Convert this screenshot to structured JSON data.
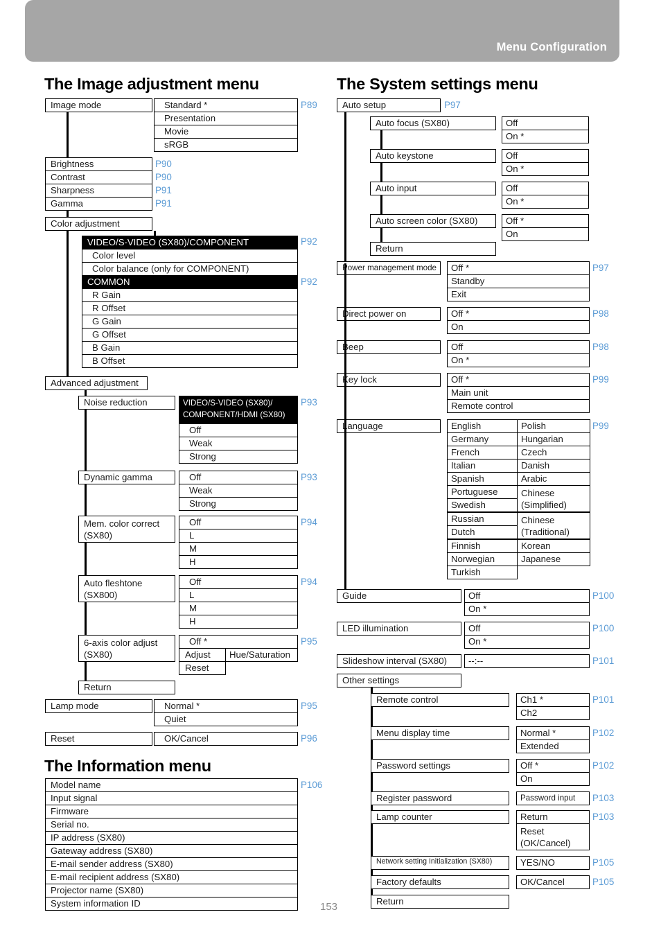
{
  "header": {
    "title": "Menu Configuration"
  },
  "page_number": "153",
  "colors": {
    "header_bg": "#a6a6a6",
    "page_ref": "#5b9bd5",
    "highlight_bg": "#000000"
  },
  "sections": {
    "image_adjustment": {
      "heading": "The Image adjustment menu",
      "image_mode": {
        "label": "Image mode",
        "ref": "P89",
        "options": [
          "Standard *",
          "Presentation",
          "Movie",
          "sRGB"
        ]
      },
      "simple_items": [
        {
          "label": "Brightness",
          "ref": "P90"
        },
        {
          "label": "Contrast",
          "ref": "P90"
        },
        {
          "label": "Sharpness",
          "ref": "P91"
        },
        {
          "label": "Gamma",
          "ref": "P91"
        }
      ],
      "color_adjustment": {
        "label": "Color adjustment",
        "groups": [
          {
            "header": "VIDEO/S-VIDEO (SX80)/COMPONENT",
            "ref": "P92",
            "items": [
              "Color level",
              "Color balance (only for COMPONENT)"
            ]
          },
          {
            "header": "COMMON",
            "ref": "P92",
            "items": [
              "R Gain",
              "R Offset",
              "G Gain",
              "G Offset",
              "B Gain",
              "B Offset"
            ]
          }
        ]
      },
      "advanced_adjustment": {
        "label": "Advanced adjustment",
        "entries": [
          {
            "label": "Noise reduction",
            "ref": "P93",
            "header": "VIDEO/S-VIDEO (SX80)/ COMPONENT/HDMI (SX80)",
            "options": [
              "Off",
              "Weak",
              "Strong"
            ]
          },
          {
            "label": "Dynamic gamma",
            "ref": "P93",
            "options": [
              "Off",
              "Weak",
              "Strong"
            ]
          },
          {
            "label": "Mem. color correct (SX80)",
            "ref": "P94",
            "options": [
              "Off",
              "L",
              "M",
              "H"
            ]
          },
          {
            "label": "Auto fleshtone (SX800)",
            "ref": "P94",
            "options": [
              "Off",
              "L",
              "M",
              "H"
            ]
          },
          {
            "label": "6-axis color adjust (SX80)",
            "ref": "P95",
            "options": [
              "Off *",
              "Adjust",
              "Reset"
            ],
            "sub_option": "Hue/Saturation"
          }
        ],
        "return_label": "Return"
      },
      "lamp_mode": {
        "label": "Lamp mode",
        "ref": "P95",
        "options": [
          "Normal *",
          "Quiet"
        ]
      },
      "reset": {
        "label": "Reset",
        "ref": "P96",
        "options": [
          "OK/Cancel"
        ]
      }
    },
    "information": {
      "heading": "The Information menu",
      "ref": "P106",
      "items": [
        "Model name",
        "Input signal",
        "Firmware",
        "Serial no.",
        "IP address (SX80)",
        "Gateway address (SX80)",
        "E-mail sender address (SX80)",
        "E-mail recipient address (SX80)",
        "Projector name (SX80)",
        "System information ID"
      ]
    },
    "system_settings": {
      "heading": "The System settings menu",
      "auto_setup": {
        "label": "Auto setup",
        "ref": "P97",
        "entries": [
          {
            "label": "Auto focus (SX80)",
            "options": [
              "Off",
              "On *"
            ]
          },
          {
            "label": "Auto keystone",
            "options": [
              "Off",
              "On *"
            ]
          },
          {
            "label": "Auto input",
            "options": [
              "Off",
              "On *"
            ]
          },
          {
            "label": "Auto screen color (SX80)",
            "options": [
              "Off *",
              "On"
            ]
          }
        ],
        "return_label": "Return"
      },
      "items": [
        {
          "label": "Power management mode",
          "ref": "P97",
          "options": [
            "Off *",
            "Standby",
            "Exit"
          ]
        },
        {
          "label": "Direct power on",
          "ref": "P98",
          "options": [
            "Off *",
            "On"
          ]
        },
        {
          "label": "Beep",
          "ref": "P98",
          "options": [
            "Off",
            "On *"
          ]
        },
        {
          "label": "Key lock",
          "ref": "P99",
          "options": [
            "Off *",
            "Main unit",
            "Remote control"
          ]
        }
      ],
      "language": {
        "label": "Language",
        "ref": "P99",
        "col1": [
          "English",
          "Germany",
          "French",
          "Italian",
          "Spanish",
          "Portuguese",
          "Swedish",
          "Russian",
          "Dutch",
          "Finnish",
          "Norwegian",
          "Turkish"
        ],
        "col2": [
          "Polish",
          "Hungarian",
          "Czech",
          "Danish",
          "Arabic",
          "Chinese (Simplified)",
          "Chinese (Traditional)",
          "Korean",
          "Japanese"
        ]
      },
      "items2": [
        {
          "label": "Guide",
          "ref": "P100",
          "options": [
            "Off",
            "On *"
          ]
        },
        {
          "label": "LED illumination",
          "ref": "P100",
          "options": [
            "Off",
            "On *"
          ]
        },
        {
          "label": "Slideshow interval (SX80)",
          "ref": "P101",
          "options": [
            "--:--"
          ]
        }
      ],
      "other_settings": {
        "label": "Other settings",
        "entries": [
          {
            "label": "Remote control",
            "ref": "P101",
            "options": [
              "Ch1 *",
              "Ch2"
            ]
          },
          {
            "label": "Menu display time",
            "ref": "P102",
            "options": [
              "Normal *",
              "Extended"
            ]
          },
          {
            "label": "Password settings",
            "ref": "P102",
            "options": [
              "Off *",
              "On"
            ]
          },
          {
            "label": "Register password",
            "ref": "P103",
            "options": [
              "Password input"
            ]
          },
          {
            "label": "Lamp counter",
            "ref": "P103",
            "options": [
              "Return",
              "Reset (OK/Cancel)"
            ]
          },
          {
            "label": "Network setting Initialization (SX80)",
            "ref": "P105",
            "options": [
              "YES/NO"
            ]
          },
          {
            "label": "Factory defaults",
            "ref": "P105",
            "options": [
              "OK/Cancel"
            ]
          }
        ],
        "return_label": "Return"
      }
    }
  }
}
